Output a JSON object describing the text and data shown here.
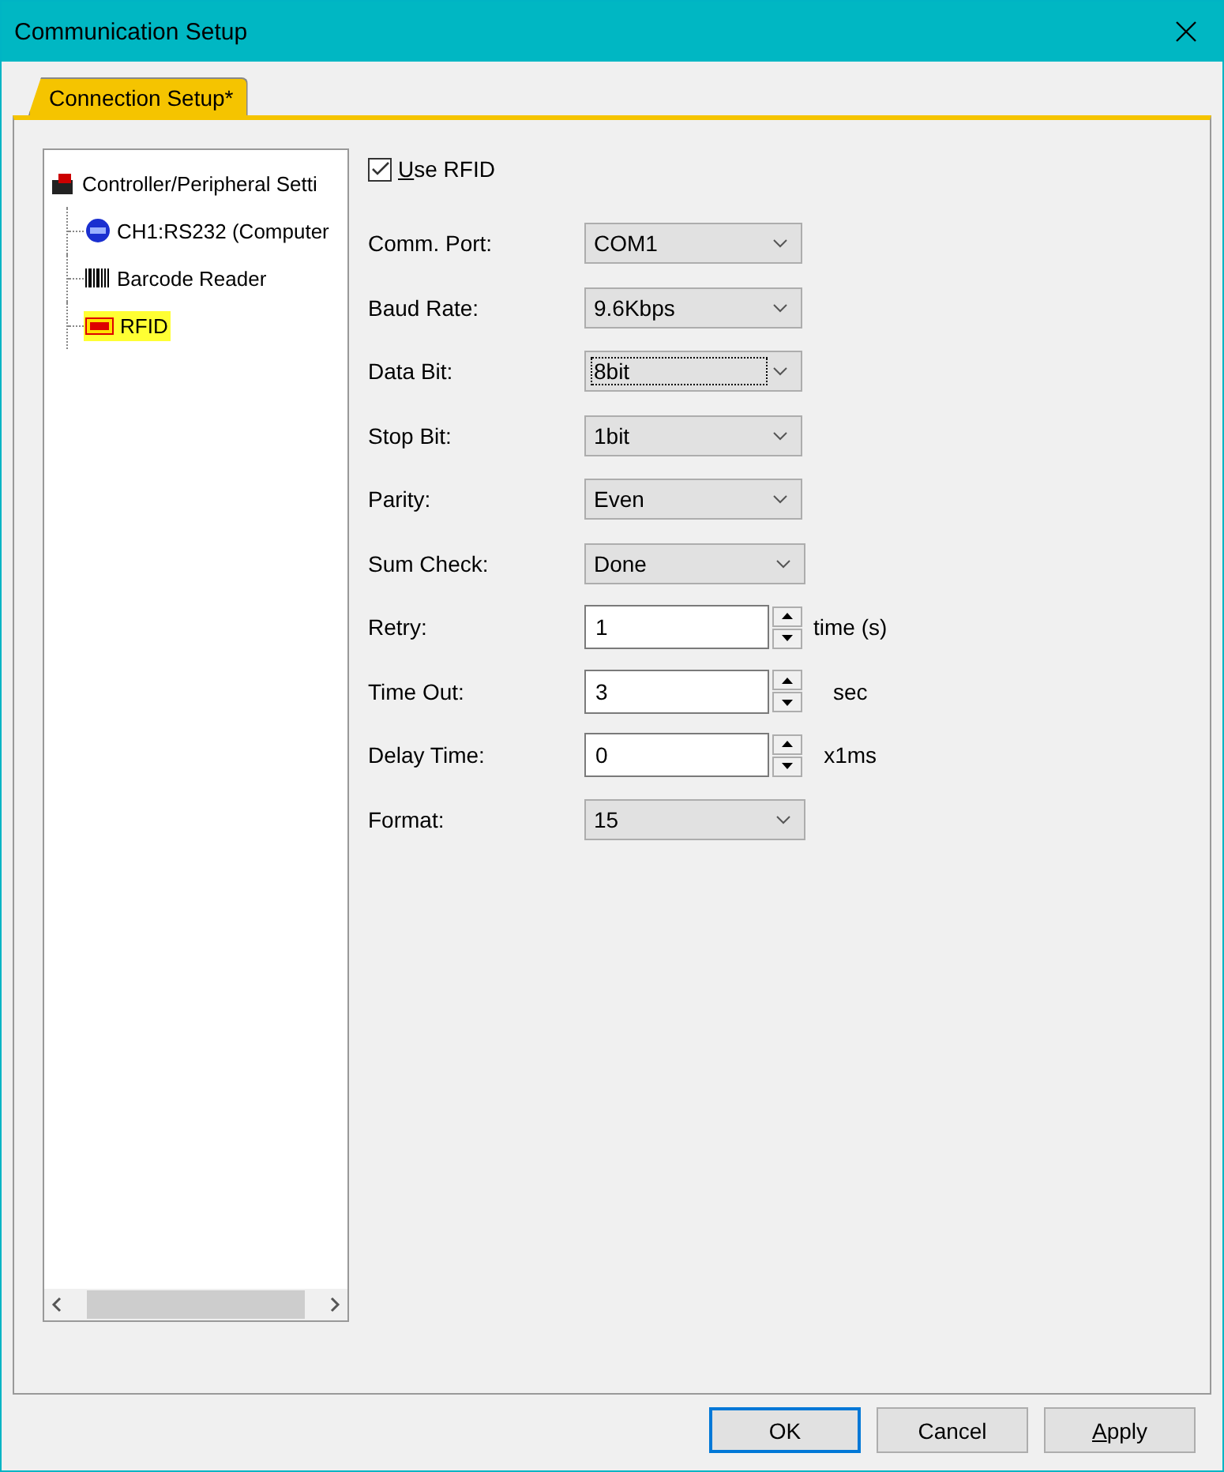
{
  "window": {
    "title": "Communication Setup"
  },
  "tabs": [
    {
      "label": "Connection Setup*",
      "selected": true
    }
  ],
  "tree": {
    "label": "Controller/Peripheral Setti",
    "expanded": true,
    "children": [
      {
        "label": "CH1:RS232 (Computer",
        "kind": "channel",
        "selected": false
      },
      {
        "label": "Barcode Reader",
        "kind": "barcode",
        "selected": false
      },
      {
        "label": "RFID",
        "kind": "rfid",
        "selected": true
      }
    ]
  },
  "use_rfid": {
    "access_key": "U",
    "label_rest": "se RFID",
    "checked": true
  },
  "fields": [
    {
      "label": "Comm. Port:",
      "kind": "select",
      "value": "COM1",
      "focused": false
    },
    {
      "label": "Baud Rate:",
      "kind": "select",
      "value": "9.6Kbps",
      "focused": false
    },
    {
      "label": "Data Bit:",
      "kind": "select",
      "value": "8bit",
      "focused": true
    },
    {
      "label": "Stop Bit:",
      "kind": "select",
      "value": "1bit",
      "focused": false
    },
    {
      "label": "Parity:",
      "kind": "select",
      "value": "Even",
      "focused": false
    },
    {
      "label": "Sum Check:",
      "kind": "select",
      "value": "Done",
      "focused": false
    },
    {
      "label": "Retry:",
      "kind": "spin",
      "value": "1",
      "unit": "time (s)"
    },
    {
      "label": "Time Out:",
      "kind": "spin",
      "value": "3",
      "unit": "sec"
    },
    {
      "label": "Delay Time:",
      "kind": "spin",
      "value": "0",
      "unit": "x1ms"
    },
    {
      "label": "Format:",
      "kind": "select",
      "value": "15",
      "focused": false
    }
  ],
  "buttons": [
    {
      "label": "OK",
      "default": true
    },
    {
      "label": "Cancel",
      "default": false
    },
    {
      "access_key": "A",
      "label_rest": "pply",
      "default": false
    }
  ]
}
